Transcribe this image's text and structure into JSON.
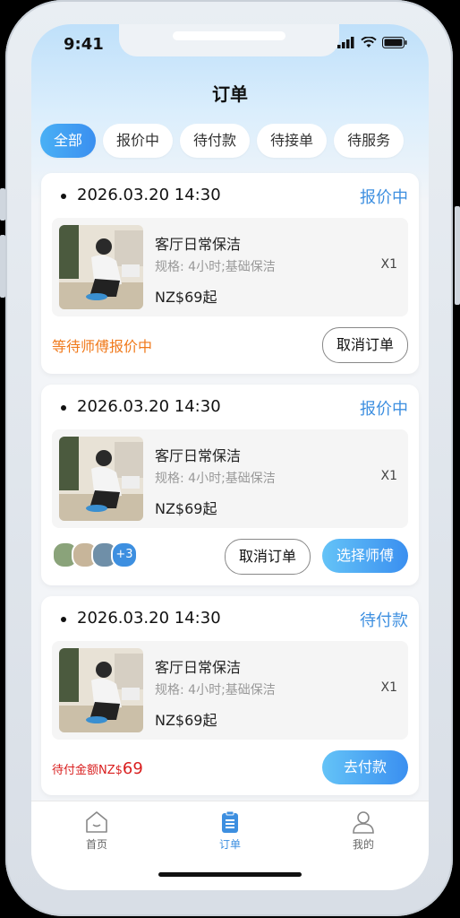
{
  "status_bar": {
    "time": "9:41"
  },
  "page_title": "订单",
  "filter_tabs": [
    {
      "label": "全部",
      "active": true
    },
    {
      "label": "报价中",
      "active": false
    },
    {
      "label": "待付款",
      "active": false
    },
    {
      "label": "待接单",
      "active": false
    },
    {
      "label": "待服务",
      "active": false
    }
  ],
  "orders": [
    {
      "datetime": "2026.03.20 14:30",
      "status": "报价中",
      "item_name": "客厅日常保洁",
      "spec": "规格: 4小时;基础保洁",
      "qty": "X1",
      "price": "NZ$69起",
      "note": "等待师傅报价中",
      "cancel_label": "取消订单"
    },
    {
      "datetime": "2026.03.20 14:30",
      "status": "报价中",
      "item_name": "客厅日常保洁",
      "spec": "规格: 4小时;基础保洁",
      "qty": "X1",
      "price": "NZ$69起",
      "extra_count": "+3",
      "cancel_label": "取消订单",
      "choose_label": "选择师傅"
    },
    {
      "datetime": "2026.03.20 14:30",
      "status": "待付款",
      "item_name": "客厅日常保洁",
      "spec": "规格: 4小时;基础保洁",
      "qty": "X1",
      "price": "NZ$69起",
      "pay_label": "待付金额NZ$",
      "pay_amount": "69",
      "pay_button": "去付款"
    }
  ],
  "tab_bar": [
    {
      "label": "首页",
      "icon": "home-icon",
      "active": false
    },
    {
      "label": "订单",
      "icon": "order-icon",
      "active": true
    },
    {
      "label": "我的",
      "icon": "profile-icon",
      "active": false
    }
  ],
  "colors": {
    "accent": "#3d8fe0",
    "warning": "#f07a1c",
    "price_red": "#d91e1e"
  }
}
